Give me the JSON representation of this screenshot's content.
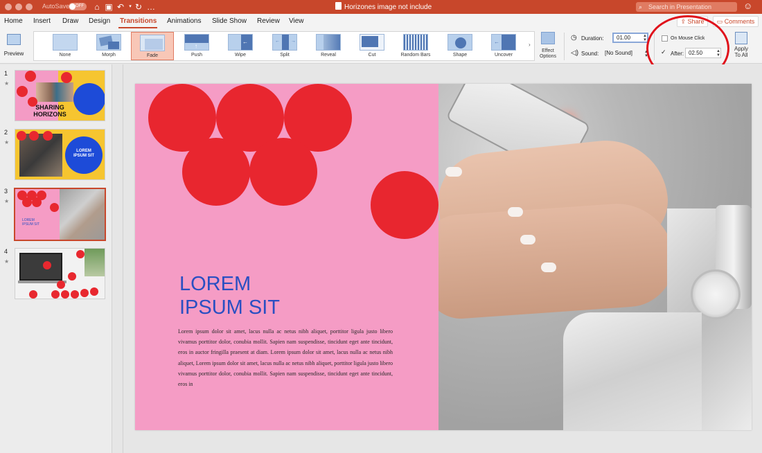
{
  "titlebar": {
    "autosave_label": "AutoSave",
    "autosave_state": "OFF",
    "document_title": "Horizones image not include",
    "search_placeholder": "Search in Presentation"
  },
  "tabs": [
    {
      "label": "Home"
    },
    {
      "label": "Insert"
    },
    {
      "label": "Draw"
    },
    {
      "label": "Design"
    },
    {
      "label": "Transitions"
    },
    {
      "label": "Animations"
    },
    {
      "label": "Slide Show"
    },
    {
      "label": "Review"
    },
    {
      "label": "View"
    }
  ],
  "active_tab": "Transitions",
  "header_buttons": {
    "share": "Share",
    "comments": "Comments"
  },
  "ribbon": {
    "preview_label": "Preview",
    "transitions": [
      {
        "label": "None"
      },
      {
        "label": "Morph"
      },
      {
        "label": "Fade"
      },
      {
        "label": "Push"
      },
      {
        "label": "Wipe"
      },
      {
        "label": "Split"
      },
      {
        "label": "Reveal"
      },
      {
        "label": "Cut"
      },
      {
        "label": "Random Bars"
      },
      {
        "label": "Shape"
      },
      {
        "label": "Uncover"
      }
    ],
    "selected_transition": "Fade",
    "effect_options_line1": "Effect",
    "effect_options_line2": "Options",
    "duration_label": "Duration:",
    "duration_value": "01.00",
    "sound_label": "Sound:",
    "sound_value": "[No Sound]",
    "on_mouse_click_label": "On Mouse Click",
    "on_mouse_click_checked": false,
    "after_label": "After:",
    "after_checked": true,
    "after_value": "02.50",
    "apply_all_line1": "Apply",
    "apply_all_line2": "To All"
  },
  "slides": [
    {
      "number": "1",
      "title_line1": "SHARING",
      "title_line2": "HORIZONS"
    },
    {
      "number": "2",
      "title_line1": "LOREM",
      "title_line2": "IPSUM SIT"
    },
    {
      "number": "3",
      "title_line1": "LOREM",
      "title_line2": "IPSUM SIT"
    },
    {
      "number": "4"
    }
  ],
  "selected_slide": "3",
  "current_slide": {
    "headline_line1": "LOREM",
    "headline_line2": "IPSUM SIT",
    "body": "Lorem ipsum dolor sit amet, lacus nulla ac netus nibh aliquet, porttitor ligula justo libero vivamus porttitor dolor, conubia mollit. Sapien nam suspendisse, tincidunt eget ante tincidunt, eros in auctor fringilla praesent at diam. Lorem ipsum dolor sit amet, lacus nulla ac netus nibh aliquet, Lorem ipsum dolor sit amet, lacus nulla ac netus nibh aliquet, porttitor ligula justo libero vivamus porttitor dolor, conubia mollit. Sapien nam suspendisse, tincidunt eget ante tincidunt, eros in"
  },
  "colors": {
    "accent": "#c8472b",
    "slide_pink": "#f59cc5",
    "circle_red": "#e8262f",
    "headline_blue": "#2a4fc2",
    "highlight_ring": "#e0111b"
  }
}
